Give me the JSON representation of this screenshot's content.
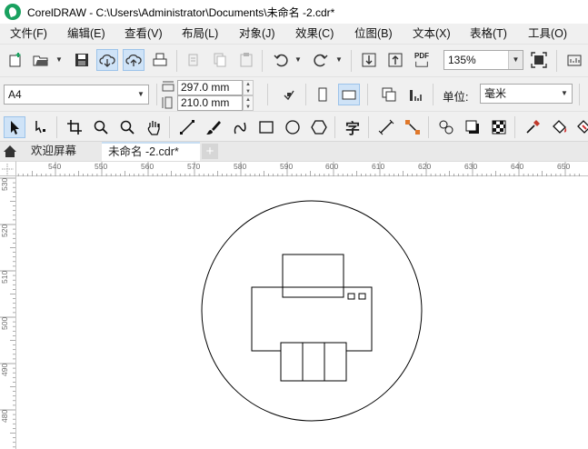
{
  "window": {
    "title": "CorelDRAW - C:\\Users\\Administrator\\Documents\\未命名 -2.cdr*"
  },
  "menu": [
    {
      "label": "文件(F)",
      "name": "menu-file"
    },
    {
      "label": "编辑(E)",
      "name": "menu-edit"
    },
    {
      "label": "查看(V)",
      "name": "menu-view"
    },
    {
      "label": "布局(L)",
      "name": "menu-layout"
    },
    {
      "label": "对象(J)",
      "name": "menu-object"
    },
    {
      "label": "效果(C)",
      "name": "menu-effects"
    },
    {
      "label": "位图(B)",
      "name": "menu-bitmaps"
    },
    {
      "label": "文本(X)",
      "name": "menu-text"
    },
    {
      "label": "表格(T)",
      "name": "menu-table"
    },
    {
      "label": "工具(O)",
      "name": "menu-tools"
    }
  ],
  "standard_toolbar": {
    "zoom_value": "135%",
    "pdf_label": "PDF"
  },
  "property_bar": {
    "page_size": "A4",
    "width_value": "297.0 mm",
    "height_value": "210.0 mm",
    "units_label": "单位:",
    "units_value": "毫米"
  },
  "toolbox": {
    "text_tool_glyph": "字"
  },
  "tabs": {
    "welcome": "欢迎屏幕",
    "document": "未命名 -2.cdr*",
    "add": "+"
  },
  "rulers": {
    "horizontal": [
      "540",
      "550",
      "560",
      "570",
      "580",
      "590",
      "600",
      "610",
      "620",
      "630",
      "640",
      "650"
    ],
    "vertical": [
      "530",
      "520",
      "510",
      "500",
      "490",
      "480"
    ]
  }
}
